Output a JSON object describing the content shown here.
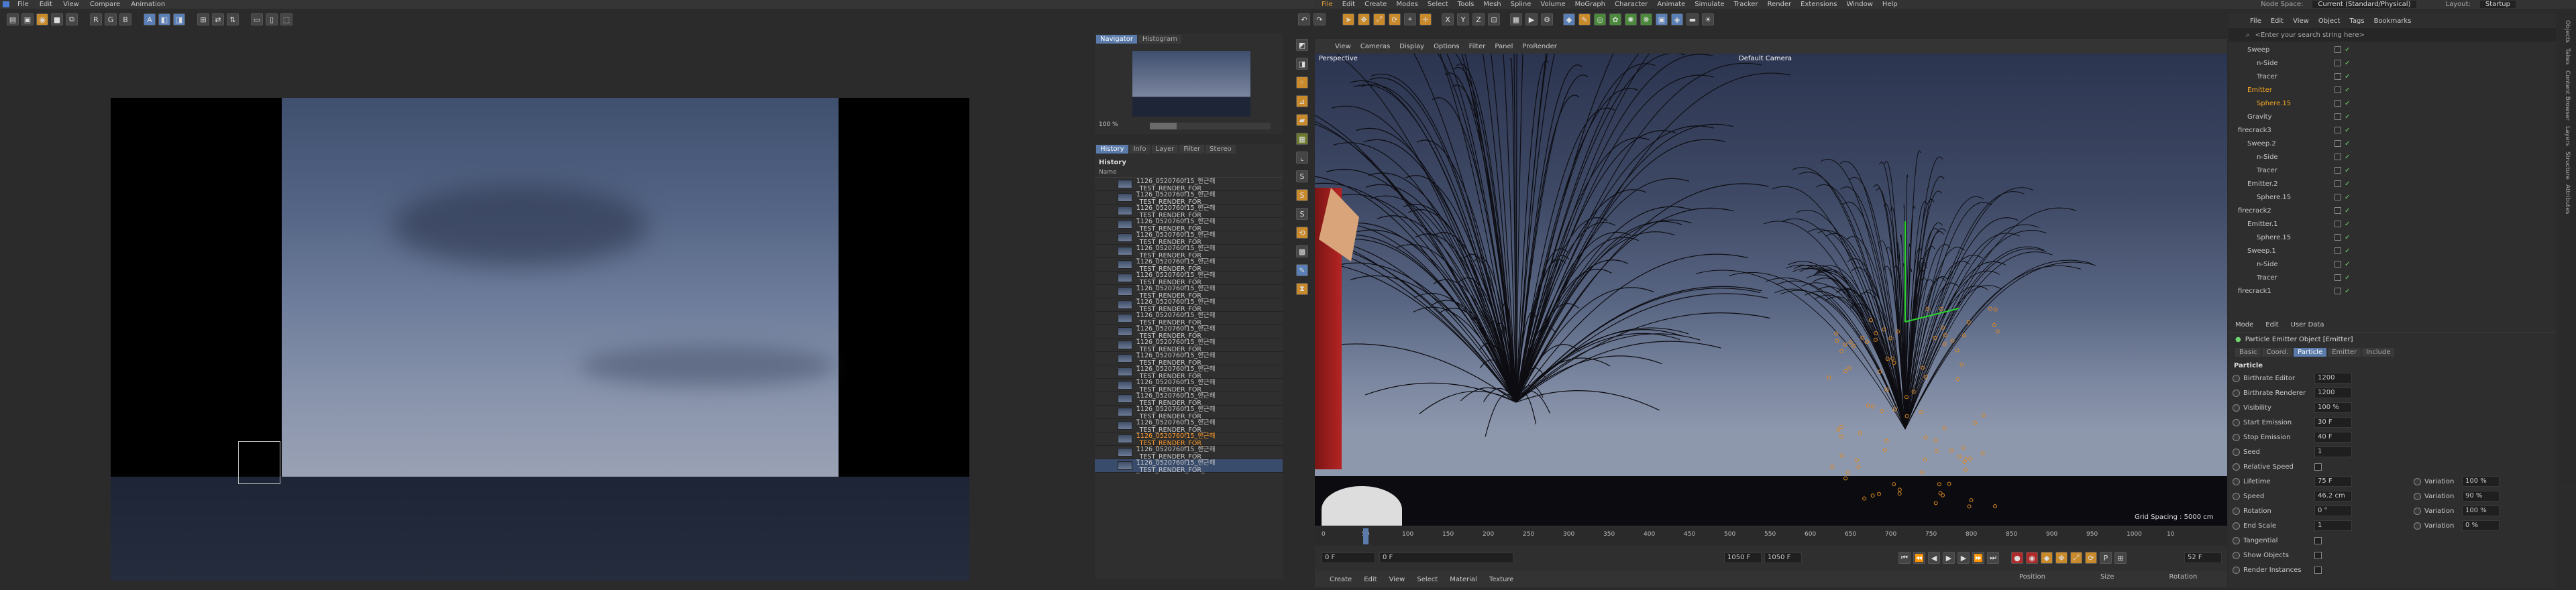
{
  "left_app": {
    "menu": [
      "File",
      "Edit",
      "View",
      "Compare",
      "Animation"
    ],
    "navigator_tabs": [
      "Navigator",
      "Histogram"
    ],
    "zoom": "100 %",
    "panel_tabs": [
      "History",
      "Info",
      "Layer",
      "Filter",
      "Stereo"
    ],
    "history_title": "History",
    "history_col": "Name",
    "history_rows": [
      "1126_0520760f15_한근해_TEST_RENDER_FOR_",
      "1126_0520760f15_한근해_TEST_RENDER_FOR_",
      "1126_0520760f15_한근해_TEST_RENDER_FOR_",
      "1126_0520760f15_한근해_TEST_RENDER_FOR_",
      "1126_0520760f15_한근해_TEST_RENDER_FOR_",
      "1126_0520760f15_한근해_TEST_RENDER_FOR_",
      "1126_0520760f15_한근해_TEST_RENDER_FOR_",
      "1126_0520760f15_한근해_TEST_RENDER_FOR_",
      "1126_0520760f15_한근해_TEST_RENDER_FOR_",
      "1126_0520760f15_한근해_TEST_RENDER_FOR_",
      "1126_0520760f15_한근해_TEST_RENDER_FOR_",
      "1126_0520760f15_한근해_TEST_RENDER_FOR_",
      "1126_0520760f15_한근해_TEST_RENDER_FOR_",
      "1126_0520760f15_한근해_TEST_RENDER_FOR_",
      "1126_0520760f15_한근해_TEST_RENDER_FOR_",
      "1126_0520760f15_한근해_TEST_RENDER_FOR_",
      "1126_0520760f15_한근해_TEST_RENDER_FOR_",
      "1126_0520760f15_한근해_TEST_RENDER_FOR_",
      "1126_0520760f15_한근해_TEST_RENDER_FOR_",
      "1126_0520760f15_한근해_TEST_RENDER_FOR_",
      "1126_0520760f15_한근해_TEST_RENDER_FOR_",
      "1126_0520760f15_한근해_TEST_RENDER_FOR_"
    ]
  },
  "c4d": {
    "menu": [
      "File",
      "Edit",
      "Create",
      "Modes",
      "Select",
      "Tools",
      "Mesh",
      "Spline",
      "Volume",
      "MoGraph",
      "Character",
      "Animate",
      "Simulate",
      "Tracker",
      "Render",
      "Extensions",
      "Window",
      "Help"
    ],
    "node_space_label": "Node Space:",
    "node_space_value": "Current (Standard/Physical)",
    "layout_label": "Layout:",
    "layout_value": "Startup",
    "viewport_menu": [
      "View",
      "Cameras",
      "Display",
      "Options",
      "Filter",
      "Panel",
      "ProRender"
    ],
    "viewport_label": "Perspective",
    "camera_label": "Default Camera",
    "grid_spacing": "Grid Spacing : 5000 cm",
    "timeline_ticks": [
      "0",
      "50",
      "100",
      "150",
      "200",
      "250",
      "300",
      "350",
      "400",
      "450",
      "500",
      "550",
      "600",
      "650",
      "700",
      "750",
      "800",
      "850",
      "900",
      "950",
      "1000",
      "10"
    ],
    "frame_start": "0 F",
    "frame_current": "0 F",
    "frame_end1": "1050 F",
    "frame_end2": "1050 F",
    "frame_right": "52 F",
    "material_menu": [
      "Create",
      "Edit",
      "View",
      "Select",
      "Material",
      "Texture"
    ],
    "coord_labels": [
      "Position",
      "Size",
      "Rotation"
    ],
    "obj_menu": [
      "File",
      "Edit",
      "View",
      "Object",
      "Tags",
      "Bookmarks"
    ],
    "obj_search": "<Enter your search string here>",
    "objects": [
      {
        "name": "Sweep",
        "indent": 1
      },
      {
        "name": "n-Side",
        "indent": 2
      },
      {
        "name": "Tracer",
        "indent": 2
      },
      {
        "name": "Emitter",
        "indent": 1,
        "color": "#f5a623"
      },
      {
        "name": "Sphere.15",
        "indent": 2,
        "color": "#f5a623"
      },
      {
        "name": "Gravity",
        "indent": 1
      },
      {
        "name": "firecrack3",
        "indent": 0
      },
      {
        "name": "Sweep.2",
        "indent": 1
      },
      {
        "name": "n-Side",
        "indent": 2
      },
      {
        "name": "Tracer",
        "indent": 2
      },
      {
        "name": "Emitter.2",
        "indent": 1
      },
      {
        "name": "Sphere.15",
        "indent": 2
      },
      {
        "name": "firecrack2",
        "indent": 0
      },
      {
        "name": "Emitter.1",
        "indent": 1
      },
      {
        "name": "Sphere.15",
        "indent": 2
      },
      {
        "name": "Sweep.1",
        "indent": 1
      },
      {
        "name": "n-Side",
        "indent": 2
      },
      {
        "name": "Tracer",
        "indent": 2
      },
      {
        "name": "firecrack1",
        "indent": 0
      }
    ],
    "attr_menu": [
      "Mode",
      "Edit",
      "User Data"
    ],
    "attr_title": "Particle Emitter Object [Emitter]",
    "attr_tabs": [
      "Basic",
      "Coord.",
      "Particle",
      "Emitter",
      "Include"
    ],
    "attr_section": "Particle",
    "params": [
      {
        "label": "Birthrate Editor",
        "value": "1200"
      },
      {
        "label": "Birthrate Renderer",
        "value": "1200"
      },
      {
        "label": "Visibility",
        "value": "100 %"
      },
      {
        "label": "Start Emission",
        "value": "30 F"
      },
      {
        "label": "Stop Emission",
        "value": "40 F"
      },
      {
        "label": "Seed",
        "value": "1"
      },
      {
        "label": "Relative Speed",
        "value": ""
      },
      {
        "label": "Lifetime",
        "value": "75 F",
        "label2": "Variation",
        "value2": "100 %"
      },
      {
        "label": "Speed",
        "value": "46.2 cm",
        "label2": "Variation",
        "value2": "90 %"
      },
      {
        "label": "Rotation",
        "value": "0 °",
        "label2": "Variation",
        "value2": "100 %"
      },
      {
        "label": "End Scale",
        "value": "1",
        "label2": "Variation",
        "value2": "0 %"
      },
      {
        "label": "Tangential",
        "value": ""
      },
      {
        "label": "Show Objects",
        "value": ""
      },
      {
        "label": "Render Instances",
        "value": ""
      }
    ],
    "side_tabs": [
      "Objects",
      "Takes",
      "Content Browser",
      "Layers",
      "Structure",
      "Attributes"
    ]
  }
}
